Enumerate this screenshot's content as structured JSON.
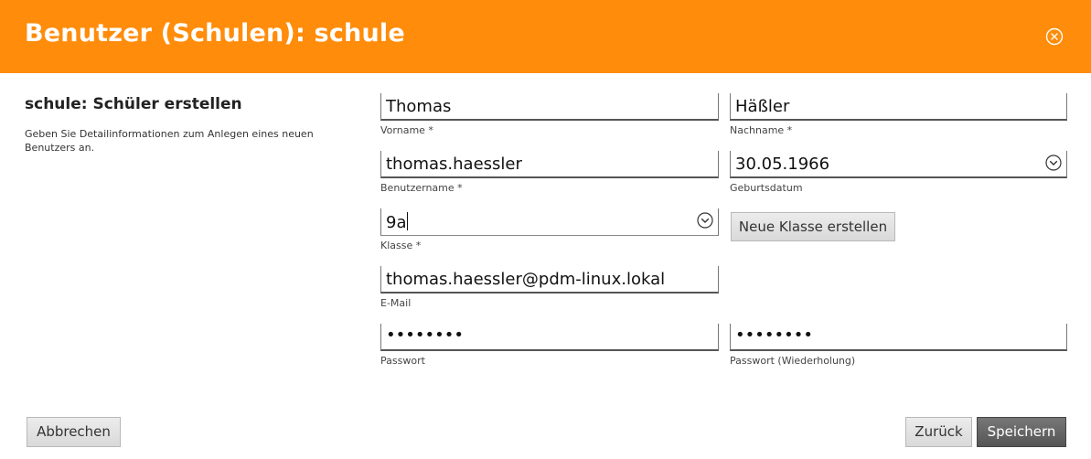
{
  "colors": {
    "accent": "#ff8c0a"
  },
  "header": {
    "title": "Benutzer (Schulen): schule",
    "close_icon": "close-circle-icon"
  },
  "left": {
    "heading": "schule: Schüler erstellen",
    "description": "Geben Sie Detailinformationen zum Anlegen eines neuen Benutzers an."
  },
  "form": {
    "vorname": {
      "value": "Thomas",
      "label": "Vorname *"
    },
    "nachname": {
      "value": "Häßler",
      "label": "Nachname *"
    },
    "benutzername": {
      "value": "thomas.haessler",
      "label": "Benutzername *"
    },
    "geburtsdatum": {
      "value": "30.05.1966",
      "label": "Geburtsdatum",
      "icon": "chevron-down-circle-icon"
    },
    "klasse": {
      "value": "9a",
      "label": "Klasse *",
      "icon": "chevron-down-circle-icon"
    },
    "neue_klasse_label": "Neue Klasse erstellen",
    "email": {
      "value": "thomas.haessler@pdm-linux.lokal",
      "label": "E-Mail"
    },
    "passwort": {
      "value": "••••••••",
      "label": "Passwort"
    },
    "passwort2": {
      "value": "••••••••",
      "label": "Passwort (Wiederholung)"
    }
  },
  "footer": {
    "cancel_label": "Abbrechen",
    "back_label": "Zurück",
    "save_label": "Speichern"
  }
}
